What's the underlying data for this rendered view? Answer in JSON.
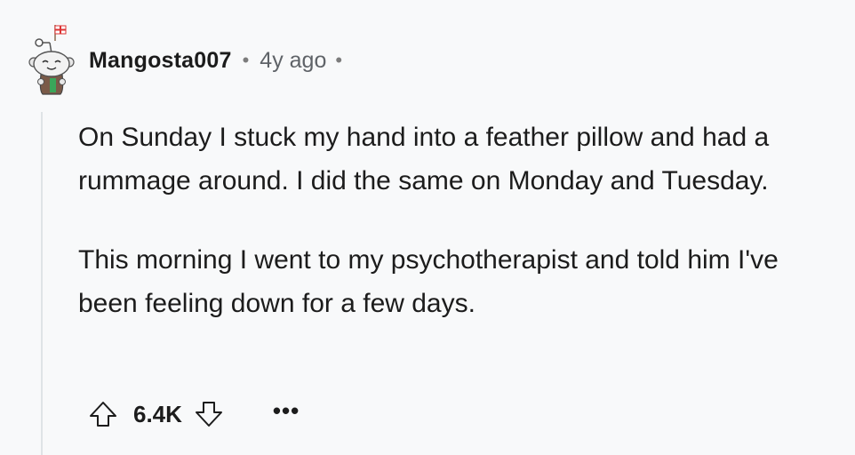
{
  "comment": {
    "author": "Mangosta007",
    "separator": "•",
    "timestamp": "4y ago",
    "trailing_separator": "•",
    "paragraphs": [
      "On Sunday I stuck my hand into a feather pillow and had a rummage around. I did the same on Monday and Tuesday.",
      "This morning I went to my psychotherapist and told him I've been feeling down for a few days."
    ],
    "score": "6.4K",
    "more_label": "•••"
  },
  "icons": {
    "avatar": "snoo-avatar-icon",
    "upvote": "arrow-up-icon",
    "downvote": "arrow-down-icon"
  },
  "colors": {
    "background": "#f8f9fa",
    "text": "#1c1c1c",
    "muted": "#5f6368",
    "thread_line": "#dfe3e6"
  }
}
